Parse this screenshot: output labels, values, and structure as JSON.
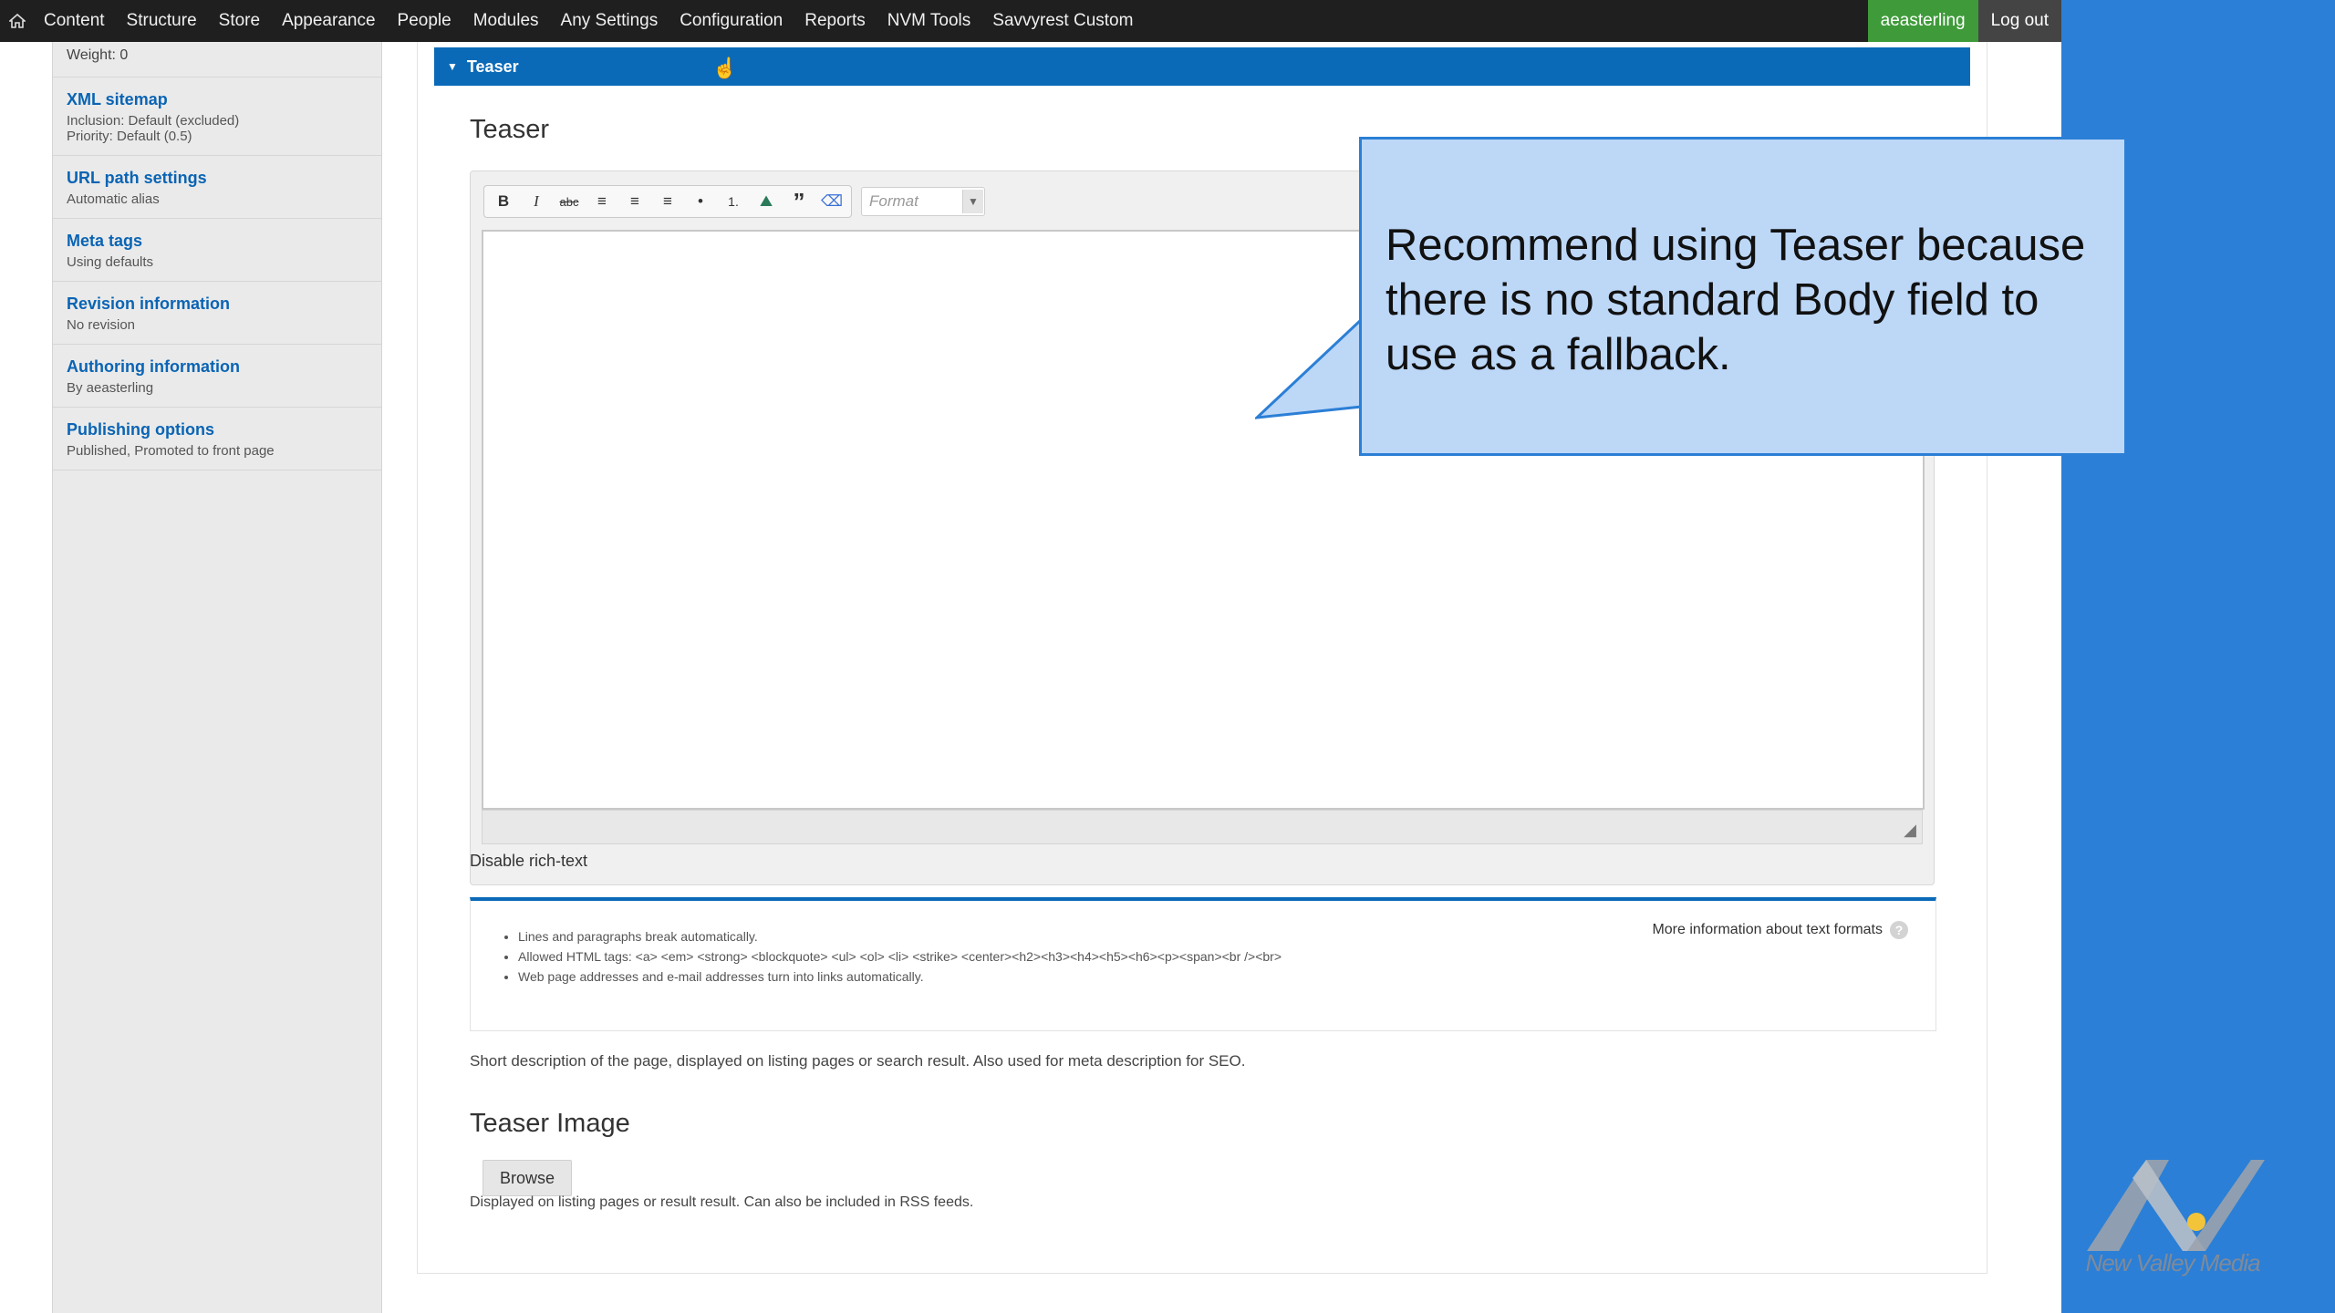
{
  "toolbar": {
    "items": [
      "Content",
      "Structure",
      "Store",
      "Appearance",
      "People",
      "Modules",
      "Any Settings",
      "Configuration",
      "Reports",
      "NVM Tools",
      "Savvyrest Custom"
    ],
    "user": "aeasterling",
    "logout": "Log out"
  },
  "sidebar": {
    "weight": "Weight: 0",
    "tabs": [
      {
        "title": "XML sitemap",
        "summary": [
          "Inclusion: Default (excluded)",
          "Priority: Default (0.5)"
        ]
      },
      {
        "title": "URL path settings",
        "summary": [
          "Automatic alias"
        ]
      },
      {
        "title": "Meta tags",
        "summary": [
          "Using defaults"
        ]
      },
      {
        "title": "Revision information",
        "summary": [
          "No revision"
        ]
      },
      {
        "title": "Authoring information",
        "summary": [
          "By aeasterling"
        ]
      },
      {
        "title": "Publishing options",
        "summary": [
          "Published, Promoted to front page"
        ]
      }
    ]
  },
  "main": {
    "fieldset_title": "Teaser",
    "field_label": "Teaser",
    "editor": {
      "buttons": [
        "B",
        "I",
        "abc",
        "≡",
        "≡",
        "≡",
        "•",
        "1.",
        "⛰",
        "”",
        "⌫"
      ],
      "format_placeholder": "Format"
    },
    "disable_rich_text": "Disable rich-text",
    "text_formats": {
      "tips": [
        "Lines and paragraphs break automatically.",
        "Allowed HTML tags: <a> <em> <strong> <blockquote> <ul> <ol> <li> <strike> <center><h2><h3><h4><h5><h6><p><span><br /><br>",
        "Web page addresses and e-mail addresses turn into links automatically."
      ],
      "more_info": "More information about text formats"
    },
    "description": "Short description of the page, displayed on listing pages or search result. Also used for meta description for SEO.",
    "teaser_image_label": "Teaser Image",
    "browse": "Browse",
    "teaser_image_desc": "Displayed on listing pages or result result. Can also be included in RSS feeds."
  },
  "callout": {
    "text": "Recommend using Teaser because there is no standard Body field to use as a fallback."
  },
  "logo": {
    "text": "New Valley Media"
  },
  "colors": {
    "accent_blue": "#0a6ab8",
    "background_blue": "#2b7fd6",
    "callout_fill": "#bdd7f7",
    "user_green": "#3f9b3a"
  }
}
